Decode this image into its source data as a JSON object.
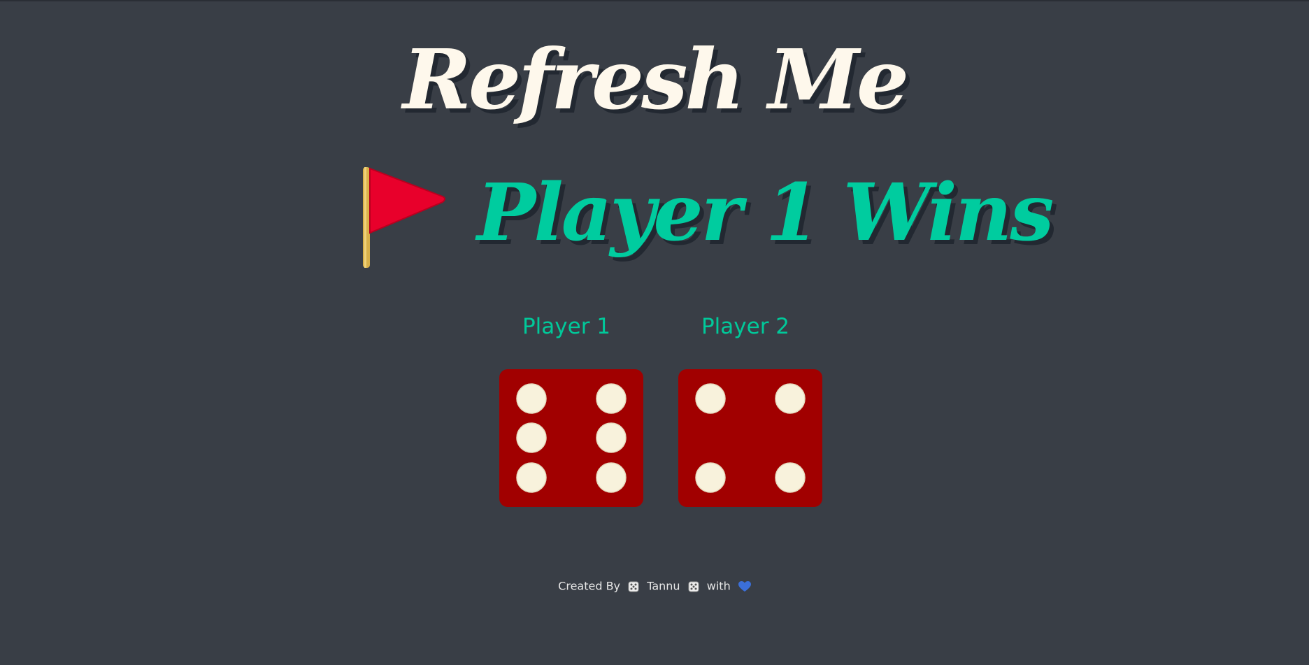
{
  "header": {
    "title": "Refresh Me"
  },
  "result": {
    "icon": "red-flag-icon",
    "text": "Player 1 Wins",
    "text_color": "#00cc9f"
  },
  "players": [
    {
      "name": "Player 1",
      "die_value": 6
    },
    {
      "name": "Player 2",
      "die_value": 4
    }
  ],
  "colors": {
    "background": "#393e46",
    "die_face": "#a10000",
    "die_pip": "#f8f2dc",
    "title": "#fef8ec",
    "accent": "#00cc9f"
  },
  "footer": {
    "prefix": "Created By",
    "author": "Tannu",
    "suffix": "with",
    "icons": [
      "die-icon",
      "die-icon",
      "blue-heart-icon"
    ]
  }
}
